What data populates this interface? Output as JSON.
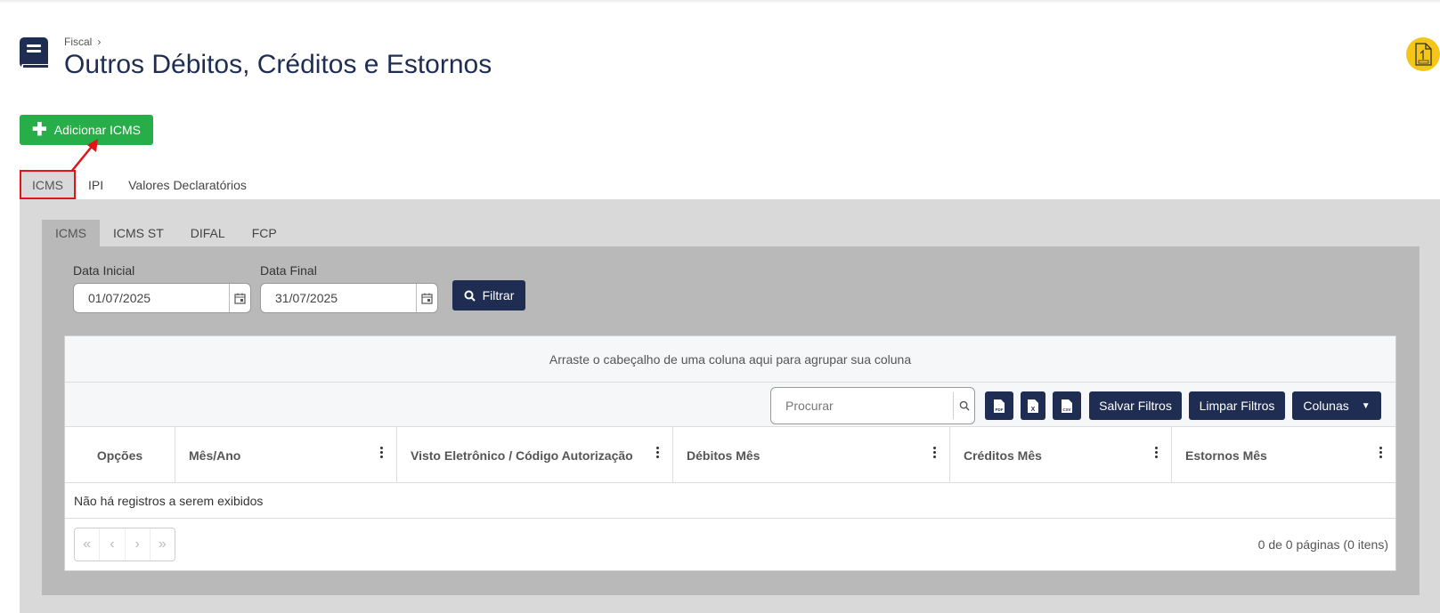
{
  "breadcrumb": {
    "parent": "Fiscal",
    "separator": "›"
  },
  "page": {
    "title": "Outros Débitos, Créditos e Estornos"
  },
  "actions": {
    "add_label": "Adicionar ICMS"
  },
  "outer_tabs": [
    "ICMS",
    "IPI",
    "Valores Declaratórios"
  ],
  "inner_tabs": [
    "ICMS",
    "ICMS ST",
    "DIFAL",
    "FCP"
  ],
  "filters": {
    "start_label": "Data Inicial",
    "start_value": "01/07/2025",
    "end_label": "Data Final",
    "end_value": "31/07/2025",
    "filter_button": "Filtrar"
  },
  "grid": {
    "group_hint": "Arraste o cabeçalho de uma coluna aqui para agrupar sua coluna",
    "search_placeholder": "Procurar",
    "export_pdf": "PDF",
    "export_excel": "X",
    "export_csv": "CSV",
    "save_filters": "Salvar Filtros",
    "clear_filters": "Limpar Filtros",
    "columns_button": "Colunas",
    "columns": [
      "Opções",
      "Mês/Ano",
      "Visto Eletrônico / Código Autorização",
      "Débitos Mês",
      "Créditos Mês",
      "Estornos Mês"
    ],
    "empty_message": "Não há registros a serem exibidos",
    "pager": [
      "«",
      "‹",
      "›",
      "»"
    ],
    "page_info": "0 de 0 páginas (0 itens)"
  },
  "colors": {
    "primary": "#1f2d52",
    "success": "#27ae48",
    "highlight": "#e0141b",
    "help": "#f5c518"
  }
}
